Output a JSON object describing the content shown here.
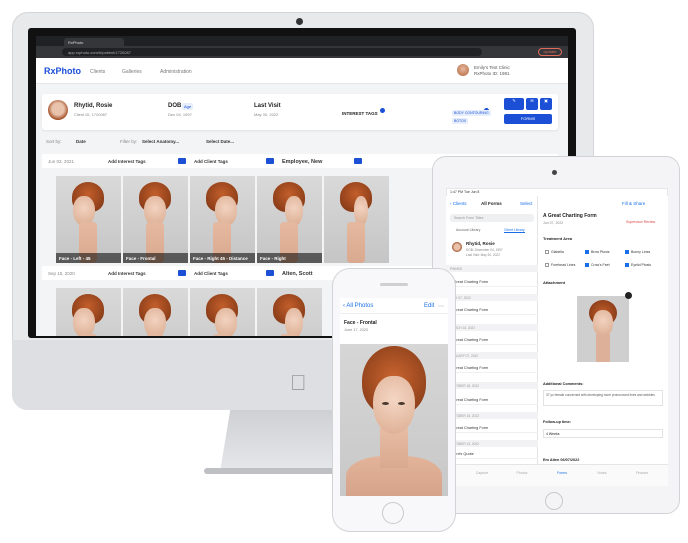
{
  "browser": {
    "tab_title": "RxPhoto",
    "url": "app.rxphoto.com/#/patient/1720087",
    "update_label": "Update"
  },
  "app": {
    "logo": "RxPhoto",
    "nav": [
      "Clients",
      "Galleries",
      "Administration"
    ],
    "clinic_name": "Emily's Test Clinic",
    "clinic_id": "RxPhoto ID: 1981"
  },
  "patient": {
    "name": "Rhytid, Rosie",
    "client_id": "Client ID: 1720087",
    "dob_label": "DOB",
    "age_badge": "Age",
    "dob_value": "Dec 04, 1997",
    "last_visit_label": "Last Visit",
    "last_visit_value": "May 30, 2022",
    "interest_tags_label": "INTEREST TAGS",
    "client_tags_label": "CLIENT TAGS",
    "client_tags": [
      "BODY CONTOURING",
      "BOTOX"
    ],
    "forms_label": "FORMS"
  },
  "filters": {
    "sort_by_label": "Sort by:",
    "sort_by_value": "Date",
    "filter_by_label": "Filter by:",
    "anatomy_value": "Select Anatomy...",
    "date_value": "Select Date..."
  },
  "sessions": [
    {
      "date": "Jun 02, 2021",
      "add_interest": "Add Interest Tags",
      "add_client": "Add Client Tags",
      "provider": "Employee, New",
      "photos": [
        "Face - Left - 45",
        "Face - Frontal",
        "Face - Right 45 - Distance",
        "Face - Right",
        ""
      ]
    },
    {
      "date": "Sep 15, 2020",
      "add_interest": "Add Interest Tags",
      "add_client": "Add Client Tags",
      "provider": "Alten, Scott"
    }
  ],
  "ipad": {
    "status_time": "1:47 PM  Tue Jun 8",
    "back_label": "Clients",
    "filter_label": "All Forms",
    "select_label": "Select",
    "search_placeholder": "Search Form Titles",
    "segments": [
      "Account Library",
      "Client Library"
    ],
    "patient_name": "Rhytid, Rosie",
    "patient_dob": "DOB: December 04, 1997",
    "patient_last_visit": "Last Visit: May 30, 2022",
    "pinned_label": "PINNED",
    "forms": [
      {
        "date": "",
        "title": "A Great Charting Form"
      },
      {
        "date": "JULY 07, 2022",
        "title": "A Great Charting Form"
      },
      {
        "date": "MARCH 16, 2022",
        "title": "A Great Charting Form"
      },
      {
        "date": "JANUARY 07, 2022",
        "title": "A Great Charting Form"
      },
      {
        "date": "OCTOBER 18, 2022",
        "title": "A Great Charting Form"
      },
      {
        "date": "OCTOBER 15, 2022",
        "title": "A Great Charting Form"
      },
      {
        "date": "OCTOBER 13, 2022",
        "title": "Client's Quote"
      },
      {
        "date": "OCTOBER 07, 2022",
        "title": "A Great Charting Form"
      }
    ],
    "detail_title": "A Great Charting Form",
    "detail_date": "Jun 07, 2022",
    "supervisor_review": "Supervisor Review",
    "fill_share": "Fill & Share",
    "treatment_area_label": "Treatment Area",
    "checkboxes": [
      {
        "label": "Glabella",
        "checked": false
      },
      {
        "label": "Brow Ptosis",
        "checked": true
      },
      {
        "label": "Bunny Lines",
        "checked": true
      },
      {
        "label": "Forehead Lines",
        "checked": false
      },
      {
        "label": "Crow's Feet",
        "checked": true
      },
      {
        "label": "Eyelid Ptosis",
        "checked": true
      }
    ],
    "attachment_label": "Attachment",
    "comments_label": "Additional Comments:",
    "comments_text": "37 yo female concerned with developing more pronounced lines and wrinkles",
    "followup_label": "Follow-up time:",
    "followup_value": "4 Weeks",
    "signature": "Em Alten 06/07/2022",
    "tabs": [
      "Capture",
      "Photos",
      "Forms",
      "Notes",
      "Finance"
    ]
  },
  "iphone": {
    "back_label": "All Photos",
    "edit_label": "Edit",
    "photo_title": "Face - Frontal",
    "photo_date": "June 17, 2020"
  }
}
